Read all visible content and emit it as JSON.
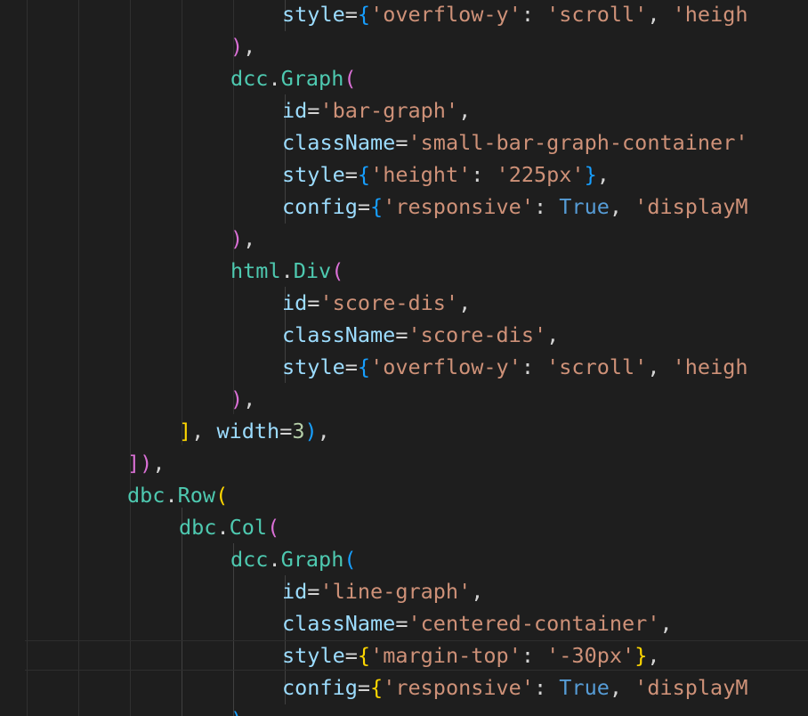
{
  "editor": {
    "theme_background": "#1e1e1e",
    "lines": [
      {
        "indent": 6,
        "tokens": [
          [
            "attr",
            "style"
          ],
          [
            "punc",
            "="
          ],
          [
            "b3",
            "{"
          ],
          [
            "str",
            "'overflow-y'"
          ],
          [
            "punc",
            ": "
          ],
          [
            "str",
            "'scroll'"
          ],
          [
            "punc",
            ", "
          ],
          [
            "str",
            "'heigh"
          ]
        ]
      },
      {
        "indent": 5,
        "tokens": [
          [
            "b2",
            ")"
          ],
          [
            "punc",
            ","
          ]
        ]
      },
      {
        "indent": 5,
        "tokens": [
          [
            "mod",
            "dcc"
          ],
          [
            "punc",
            "."
          ],
          [
            "mod",
            "Graph"
          ],
          [
            "b2",
            "("
          ]
        ]
      },
      {
        "indent": 6,
        "tokens": [
          [
            "attr",
            "id"
          ],
          [
            "punc",
            "="
          ],
          [
            "str",
            "'bar-graph'"
          ],
          [
            "punc",
            ","
          ]
        ]
      },
      {
        "indent": 6,
        "tokens": [
          [
            "attr",
            "className"
          ],
          [
            "punc",
            "="
          ],
          [
            "str",
            "'small-bar-graph-container'"
          ]
        ]
      },
      {
        "indent": 6,
        "tokens": [
          [
            "attr",
            "style"
          ],
          [
            "punc",
            "="
          ],
          [
            "b3",
            "{"
          ],
          [
            "str",
            "'height'"
          ],
          [
            "punc",
            ": "
          ],
          [
            "str",
            "'225px'"
          ],
          [
            "b3",
            "}"
          ],
          [
            "punc",
            ","
          ]
        ]
      },
      {
        "indent": 6,
        "tokens": [
          [
            "attr",
            "config"
          ],
          [
            "punc",
            "="
          ],
          [
            "b3",
            "{"
          ],
          [
            "str",
            "'responsive'"
          ],
          [
            "punc",
            ": "
          ],
          [
            "kw",
            "True"
          ],
          [
            "punc",
            ", "
          ],
          [
            "str",
            "'displayM"
          ]
        ]
      },
      {
        "indent": 5,
        "tokens": [
          [
            "b2",
            ")"
          ],
          [
            "punc",
            ","
          ]
        ]
      },
      {
        "indent": 5,
        "tokens": [
          [
            "mod",
            "html"
          ],
          [
            "punc",
            "."
          ],
          [
            "mod",
            "Div"
          ],
          [
            "b2",
            "("
          ]
        ]
      },
      {
        "indent": 6,
        "tokens": [
          [
            "attr",
            "id"
          ],
          [
            "punc",
            "="
          ],
          [
            "str",
            "'score-dis'"
          ],
          [
            "punc",
            ","
          ]
        ]
      },
      {
        "indent": 6,
        "tokens": [
          [
            "attr",
            "className"
          ],
          [
            "punc",
            "="
          ],
          [
            "str",
            "'score-dis'"
          ],
          [
            "punc",
            ","
          ]
        ]
      },
      {
        "indent": 6,
        "tokens": [
          [
            "attr",
            "style"
          ],
          [
            "punc",
            "="
          ],
          [
            "b3",
            "{"
          ],
          [
            "str",
            "'overflow-y'"
          ],
          [
            "punc",
            ": "
          ],
          [
            "str",
            "'scroll'"
          ],
          [
            "punc",
            ", "
          ],
          [
            "str",
            "'heigh"
          ]
        ]
      },
      {
        "indent": 5,
        "tokens": [
          [
            "b2",
            ")"
          ],
          [
            "punc",
            ","
          ]
        ]
      },
      {
        "indent": 4,
        "tokens": [
          [
            "b1",
            "]"
          ],
          [
            "punc",
            ", "
          ],
          [
            "attr",
            "width"
          ],
          [
            "punc",
            "="
          ],
          [
            "num",
            "3"
          ],
          [
            "b3",
            ")"
          ],
          [
            "punc",
            ","
          ]
        ]
      },
      {
        "indent": 3,
        "tokens": [
          [
            "b2",
            "]"
          ],
          [
            "b2",
            ")"
          ],
          [
            "punc",
            ","
          ]
        ]
      },
      {
        "indent": 3,
        "tokens": [
          [
            "mod",
            "dbc"
          ],
          [
            "punc",
            "."
          ],
          [
            "mod",
            "Row"
          ],
          [
            "b1",
            "("
          ]
        ]
      },
      {
        "indent": 4,
        "tokens": [
          [
            "mod",
            "dbc"
          ],
          [
            "punc",
            "."
          ],
          [
            "mod",
            "Col"
          ],
          [
            "b2",
            "("
          ]
        ]
      },
      {
        "indent": 5,
        "tokens": [
          [
            "mod",
            "dcc"
          ],
          [
            "punc",
            "."
          ],
          [
            "mod",
            "Graph"
          ],
          [
            "b3",
            "("
          ]
        ]
      },
      {
        "indent": 6,
        "tokens": [
          [
            "attr",
            "id"
          ],
          [
            "punc",
            "="
          ],
          [
            "str",
            "'line-graph'"
          ],
          [
            "punc",
            ","
          ]
        ]
      },
      {
        "indent": 6,
        "tokens": [
          [
            "attr",
            "className"
          ],
          [
            "punc",
            "="
          ],
          [
            "str",
            "'centered-container'"
          ],
          [
            "punc",
            ","
          ]
        ]
      },
      {
        "indent": 6,
        "tokens": [
          [
            "attr",
            "style"
          ],
          [
            "punc",
            "="
          ],
          [
            "b1",
            "{"
          ],
          [
            "str",
            "'margin-top'"
          ],
          [
            "punc",
            ": "
          ],
          [
            "str",
            "'-30px'"
          ],
          [
            "b1",
            "}"
          ],
          [
            "punc",
            ","
          ]
        ]
      },
      {
        "indent": 6,
        "tokens": [
          [
            "attr",
            "config"
          ],
          [
            "punc",
            "="
          ],
          [
            "b1",
            "{"
          ],
          [
            "str",
            "'responsive'"
          ],
          [
            "punc",
            ": "
          ],
          [
            "kw",
            "True"
          ],
          [
            "punc",
            ", "
          ],
          [
            "str",
            "'displayM"
          ]
        ]
      },
      {
        "indent": 5,
        "tokens": [
          [
            "b3",
            ")"
          ]
        ]
      }
    ]
  }
}
